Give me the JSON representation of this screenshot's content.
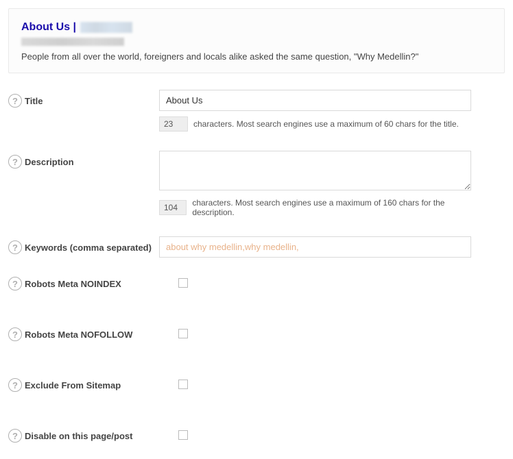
{
  "preview": {
    "title_prefix": "About Us | ",
    "description": "People from all over the world, foreigners and locals alike asked the same question, \"Why Medellin?\""
  },
  "fields": {
    "title": {
      "label": "Title",
      "value": "About Us",
      "count": "23",
      "hint": "characters. Most search engines use a maximum of 60 chars for the title."
    },
    "description": {
      "label": "Description",
      "value": "",
      "count": "104",
      "hint": "characters. Most search engines use a maximum of 160 chars for the description."
    },
    "keywords": {
      "label": "Keywords (comma separated)",
      "value": "about why medellin,why medellin,"
    },
    "noindex": {
      "label": "Robots Meta NOINDEX"
    },
    "nofollow": {
      "label": "Robots Meta NOFOLLOW"
    },
    "exclude_sitemap": {
      "label": "Exclude From Sitemap"
    },
    "disable": {
      "label": "Disable on this page/post"
    }
  }
}
